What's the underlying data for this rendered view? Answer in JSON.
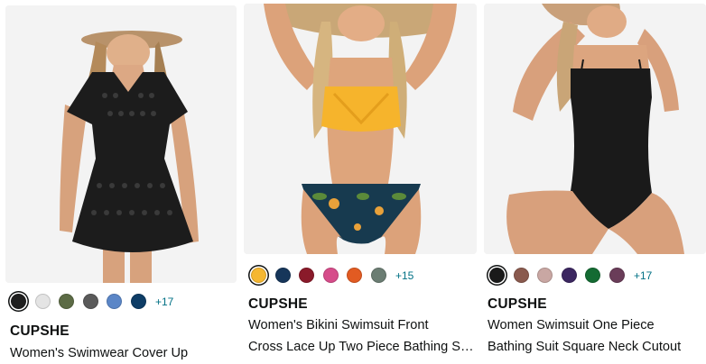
{
  "products": [
    {
      "brand": "CUPSHE",
      "title_line1": "Women's Swimwear Cover Up",
      "title_line2": "",
      "more_colors": "+17",
      "swatch_colors": [
        "#1f1f1f",
        "#e4e4e4",
        "#5c6b45",
        "#5a5a5a",
        "#5b86c7",
        "#0e3d66"
      ],
      "image": "woman wearing black crochet cover-up dress and straw hat"
    },
    {
      "brand": "CUPSHE",
      "title_line1": "Women's Bikini Swimsuit Front",
      "title_line2": "Cross Lace Up Two Piece Bathing Suit",
      "more_colors": "+15",
      "swatch_colors": [
        "#f5b731",
        "#16365a",
        "#8a1a2a",
        "#d64c8a",
        "#e25b22",
        "#6b7d73"
      ],
      "image": "woman wearing yellow bikini top and navy tropical print bottoms"
    },
    {
      "brand": "CUPSHE",
      "title_line1": "Women Swimsuit One Piece",
      "title_line2": "Bathing Suit Square Neck Cutout",
      "more_colors": "+17",
      "swatch_colors": [
        "#1a1a1a",
        "#8a5a4e",
        "#c9a7a3",
        "#3b2660",
        "#146b33",
        "#6a3d59"
      ],
      "image": "woman wearing black one piece swimsuit and straw hat"
    }
  ]
}
